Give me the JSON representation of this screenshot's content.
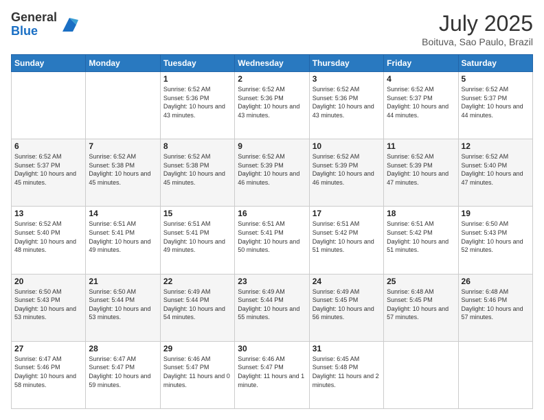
{
  "header": {
    "logo_line1": "General",
    "logo_line2": "Blue",
    "month": "July 2025",
    "location": "Boituva, Sao Paulo, Brazil"
  },
  "weekdays": [
    "Sunday",
    "Monday",
    "Tuesday",
    "Wednesday",
    "Thursday",
    "Friday",
    "Saturday"
  ],
  "weeks": [
    [
      {
        "day": "",
        "sunrise": "",
        "sunset": "",
        "daylight": ""
      },
      {
        "day": "",
        "sunrise": "",
        "sunset": "",
        "daylight": ""
      },
      {
        "day": "1",
        "sunrise": "Sunrise: 6:52 AM",
        "sunset": "Sunset: 5:36 PM",
        "daylight": "Daylight: 10 hours and 43 minutes."
      },
      {
        "day": "2",
        "sunrise": "Sunrise: 6:52 AM",
        "sunset": "Sunset: 5:36 PM",
        "daylight": "Daylight: 10 hours and 43 minutes."
      },
      {
        "day": "3",
        "sunrise": "Sunrise: 6:52 AM",
        "sunset": "Sunset: 5:36 PM",
        "daylight": "Daylight: 10 hours and 43 minutes."
      },
      {
        "day": "4",
        "sunrise": "Sunrise: 6:52 AM",
        "sunset": "Sunset: 5:37 PM",
        "daylight": "Daylight: 10 hours and 44 minutes."
      },
      {
        "day": "5",
        "sunrise": "Sunrise: 6:52 AM",
        "sunset": "Sunset: 5:37 PM",
        "daylight": "Daylight: 10 hours and 44 minutes."
      }
    ],
    [
      {
        "day": "6",
        "sunrise": "Sunrise: 6:52 AM",
        "sunset": "Sunset: 5:37 PM",
        "daylight": "Daylight: 10 hours and 45 minutes."
      },
      {
        "day": "7",
        "sunrise": "Sunrise: 6:52 AM",
        "sunset": "Sunset: 5:38 PM",
        "daylight": "Daylight: 10 hours and 45 minutes."
      },
      {
        "day": "8",
        "sunrise": "Sunrise: 6:52 AM",
        "sunset": "Sunset: 5:38 PM",
        "daylight": "Daylight: 10 hours and 45 minutes."
      },
      {
        "day": "9",
        "sunrise": "Sunrise: 6:52 AM",
        "sunset": "Sunset: 5:39 PM",
        "daylight": "Daylight: 10 hours and 46 minutes."
      },
      {
        "day": "10",
        "sunrise": "Sunrise: 6:52 AM",
        "sunset": "Sunset: 5:39 PM",
        "daylight": "Daylight: 10 hours and 46 minutes."
      },
      {
        "day": "11",
        "sunrise": "Sunrise: 6:52 AM",
        "sunset": "Sunset: 5:39 PM",
        "daylight": "Daylight: 10 hours and 47 minutes."
      },
      {
        "day": "12",
        "sunrise": "Sunrise: 6:52 AM",
        "sunset": "Sunset: 5:40 PM",
        "daylight": "Daylight: 10 hours and 47 minutes."
      }
    ],
    [
      {
        "day": "13",
        "sunrise": "Sunrise: 6:52 AM",
        "sunset": "Sunset: 5:40 PM",
        "daylight": "Daylight: 10 hours and 48 minutes."
      },
      {
        "day": "14",
        "sunrise": "Sunrise: 6:51 AM",
        "sunset": "Sunset: 5:41 PM",
        "daylight": "Daylight: 10 hours and 49 minutes."
      },
      {
        "day": "15",
        "sunrise": "Sunrise: 6:51 AM",
        "sunset": "Sunset: 5:41 PM",
        "daylight": "Daylight: 10 hours and 49 minutes."
      },
      {
        "day": "16",
        "sunrise": "Sunrise: 6:51 AM",
        "sunset": "Sunset: 5:41 PM",
        "daylight": "Daylight: 10 hours and 50 minutes."
      },
      {
        "day": "17",
        "sunrise": "Sunrise: 6:51 AM",
        "sunset": "Sunset: 5:42 PM",
        "daylight": "Daylight: 10 hours and 51 minutes."
      },
      {
        "day": "18",
        "sunrise": "Sunrise: 6:51 AM",
        "sunset": "Sunset: 5:42 PM",
        "daylight": "Daylight: 10 hours and 51 minutes."
      },
      {
        "day": "19",
        "sunrise": "Sunrise: 6:50 AM",
        "sunset": "Sunset: 5:43 PM",
        "daylight": "Daylight: 10 hours and 52 minutes."
      }
    ],
    [
      {
        "day": "20",
        "sunrise": "Sunrise: 6:50 AM",
        "sunset": "Sunset: 5:43 PM",
        "daylight": "Daylight: 10 hours and 53 minutes."
      },
      {
        "day": "21",
        "sunrise": "Sunrise: 6:50 AM",
        "sunset": "Sunset: 5:44 PM",
        "daylight": "Daylight: 10 hours and 53 minutes."
      },
      {
        "day": "22",
        "sunrise": "Sunrise: 6:49 AM",
        "sunset": "Sunset: 5:44 PM",
        "daylight": "Daylight: 10 hours and 54 minutes."
      },
      {
        "day": "23",
        "sunrise": "Sunrise: 6:49 AM",
        "sunset": "Sunset: 5:44 PM",
        "daylight": "Daylight: 10 hours and 55 minutes."
      },
      {
        "day": "24",
        "sunrise": "Sunrise: 6:49 AM",
        "sunset": "Sunset: 5:45 PM",
        "daylight": "Daylight: 10 hours and 56 minutes."
      },
      {
        "day": "25",
        "sunrise": "Sunrise: 6:48 AM",
        "sunset": "Sunset: 5:45 PM",
        "daylight": "Daylight: 10 hours and 57 minutes."
      },
      {
        "day": "26",
        "sunrise": "Sunrise: 6:48 AM",
        "sunset": "Sunset: 5:46 PM",
        "daylight": "Daylight: 10 hours and 57 minutes."
      }
    ],
    [
      {
        "day": "27",
        "sunrise": "Sunrise: 6:47 AM",
        "sunset": "Sunset: 5:46 PM",
        "daylight": "Daylight: 10 hours and 58 minutes."
      },
      {
        "day": "28",
        "sunrise": "Sunrise: 6:47 AM",
        "sunset": "Sunset: 5:47 PM",
        "daylight": "Daylight: 10 hours and 59 minutes."
      },
      {
        "day": "29",
        "sunrise": "Sunrise: 6:46 AM",
        "sunset": "Sunset: 5:47 PM",
        "daylight": "Daylight: 11 hours and 0 minutes."
      },
      {
        "day": "30",
        "sunrise": "Sunrise: 6:46 AM",
        "sunset": "Sunset: 5:47 PM",
        "daylight": "Daylight: 11 hours and 1 minute."
      },
      {
        "day": "31",
        "sunrise": "Sunrise: 6:45 AM",
        "sunset": "Sunset: 5:48 PM",
        "daylight": "Daylight: 11 hours and 2 minutes."
      },
      {
        "day": "",
        "sunrise": "",
        "sunset": "",
        "daylight": ""
      },
      {
        "day": "",
        "sunrise": "",
        "sunset": "",
        "daylight": ""
      }
    ]
  ]
}
